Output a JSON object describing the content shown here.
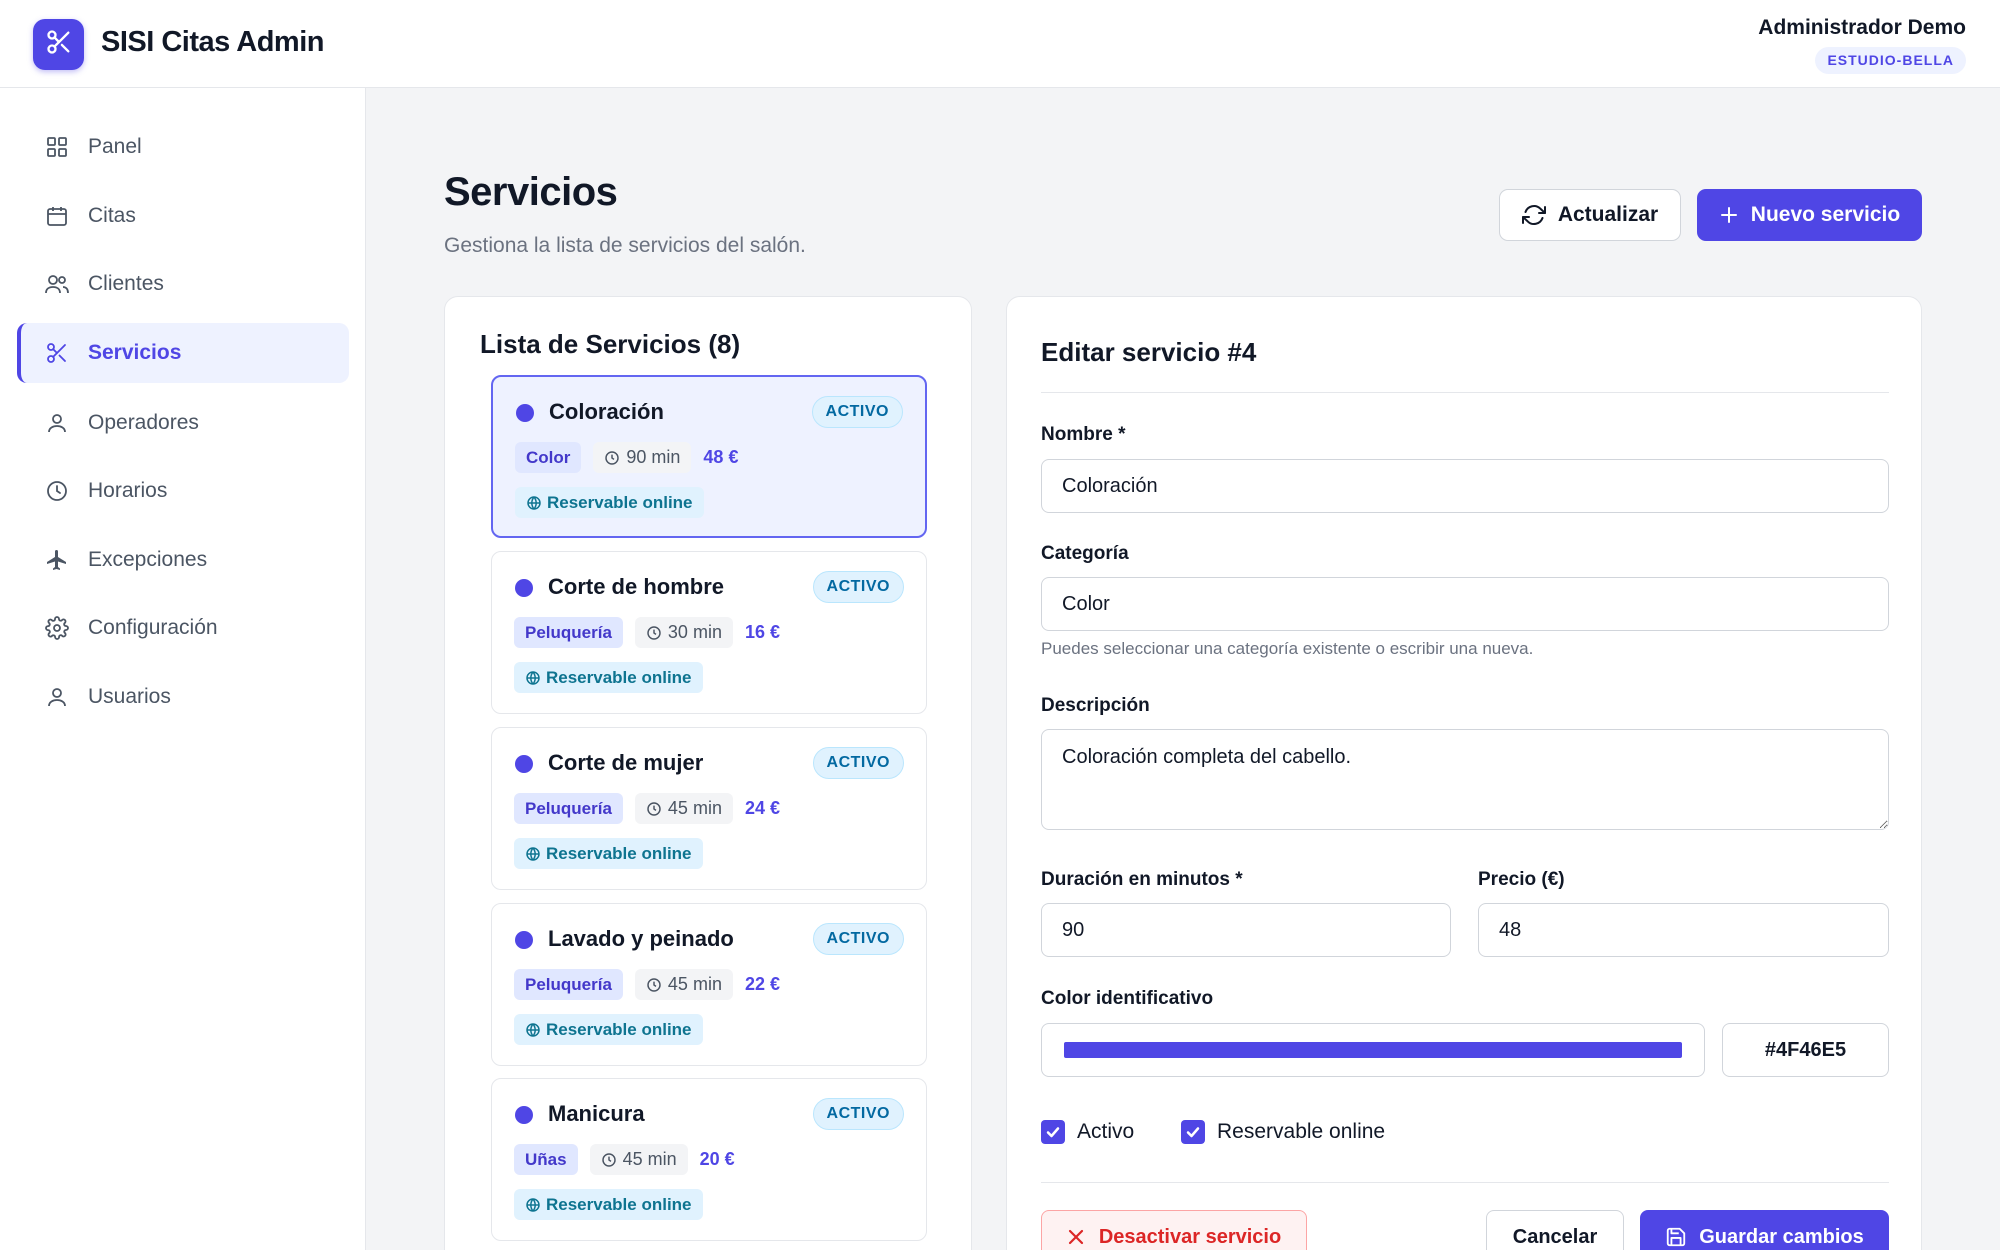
{
  "app": {
    "name": "SISI Citas Admin",
    "logo_icon": "scissors-icon"
  },
  "user": {
    "name": "Administrador Demo",
    "tenant": "ESTUDIO-BELLA"
  },
  "sidebar": {
    "items": [
      {
        "label": "Panel",
        "icon": "grid-icon",
        "active": false
      },
      {
        "label": "Citas",
        "icon": "calendar-icon",
        "active": false
      },
      {
        "label": "Clientes",
        "icon": "users-icon",
        "active": false
      },
      {
        "label": "Servicios",
        "icon": "scissors-icon",
        "active": true
      },
      {
        "label": "Operadores",
        "icon": "user-icon",
        "active": false
      },
      {
        "label": "Horarios",
        "icon": "clock-icon",
        "active": false
      },
      {
        "label": "Excepciones",
        "icon": "plane-icon",
        "active": false
      },
      {
        "label": "Configuración",
        "icon": "gear-icon",
        "active": false
      },
      {
        "label": "Usuarios",
        "icon": "user-icon",
        "active": false
      }
    ]
  },
  "page": {
    "title": "Servicios",
    "subtitle": "Gestiona la lista de servicios del salón.",
    "refresh_label": "Actualizar",
    "new_label": "Nuevo servicio"
  },
  "list": {
    "title": "Lista de Servicios (8)",
    "services": [
      {
        "name": "Coloración",
        "status": "ACTIVO",
        "category": "Color",
        "duration": "90 min",
        "price": "48 €",
        "online": "Reservable online",
        "color": "#4F46E5",
        "selected": true
      },
      {
        "name": "Corte de hombre",
        "status": "ACTIVO",
        "category": "Peluquería",
        "duration": "30 min",
        "price": "16 €",
        "online": "Reservable online",
        "color": "#4F46E5",
        "selected": false
      },
      {
        "name": "Corte de mujer",
        "status": "ACTIVO",
        "category": "Peluquería",
        "duration": "45 min",
        "price": "24 €",
        "online": "Reservable online",
        "color": "#4F46E5",
        "selected": false
      },
      {
        "name": "Lavado y peinado",
        "status": "ACTIVO",
        "category": "Peluquería",
        "duration": "45 min",
        "price": "22 €",
        "online": "Reservable online",
        "color": "#4F46E5",
        "selected": false
      },
      {
        "name": "Manicura",
        "status": "ACTIVO",
        "category": "Uñas",
        "duration": "45 min",
        "price": "20 €",
        "online": "Reservable online",
        "color": "#4F46E5",
        "selected": false
      }
    ]
  },
  "edit": {
    "title": "Editar servicio #4",
    "name_label": "Nombre *",
    "name_value": "Coloración",
    "category_label": "Categoría",
    "category_value": "Color",
    "category_hint": "Puedes seleccionar una categoría existente o escribir una nueva.",
    "description_label": "Descripción",
    "description_value": "Coloración completa del cabello.",
    "duration_label": "Duración en minutos *",
    "duration_value": "90",
    "price_label": "Precio (€)",
    "price_value": "48",
    "color_label": "Color identificativo",
    "color_value": "#4F46E5",
    "active_label": "Activo",
    "active_checked": true,
    "online_label": "Reservable online",
    "online_checked": true,
    "deactivate_label": "Desactivar servicio",
    "cancel_label": "Cancelar",
    "save_label": "Guardar cambios"
  },
  "colors": {
    "accent": "#4F46E5",
    "accent_light": "#EEF2FF",
    "danger": "#DC2626"
  }
}
